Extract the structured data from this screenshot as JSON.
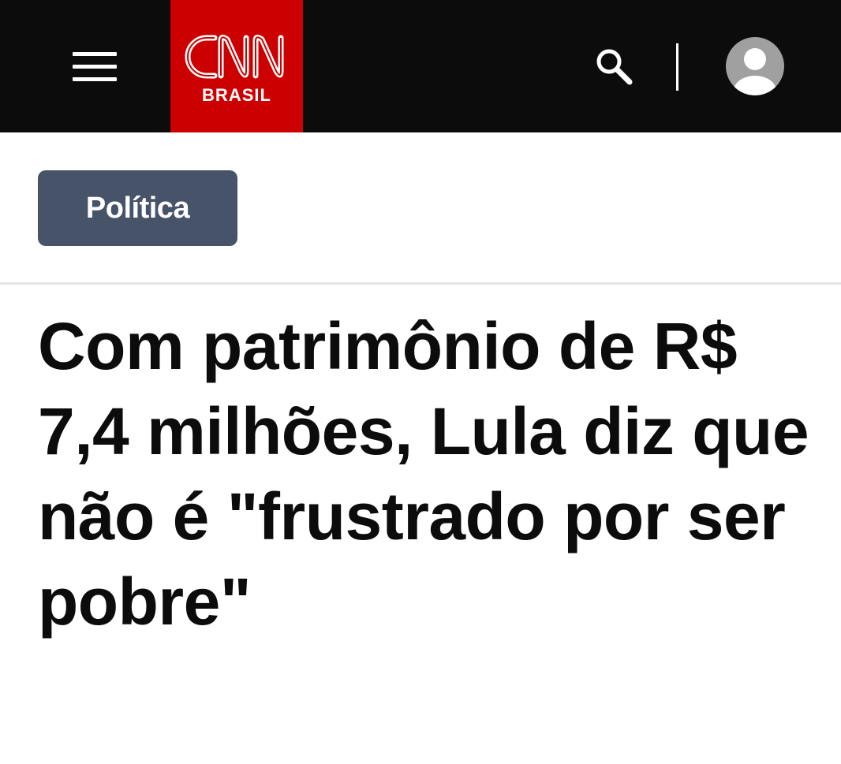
{
  "header": {
    "brand": {
      "name": "CNN",
      "sub": "BRASIL",
      "color": "#cc0000"
    },
    "menu_icon": "hamburger-menu-icon",
    "search_icon": "search-icon",
    "account_icon": "user-avatar-icon",
    "background": "#0c0c0c"
  },
  "article": {
    "category": "Política",
    "category_color": "#465368",
    "headline": "Com patrimônio de R$ 7,4 milhões, Lula diz que não é \"frustrado por ser pobre\""
  }
}
